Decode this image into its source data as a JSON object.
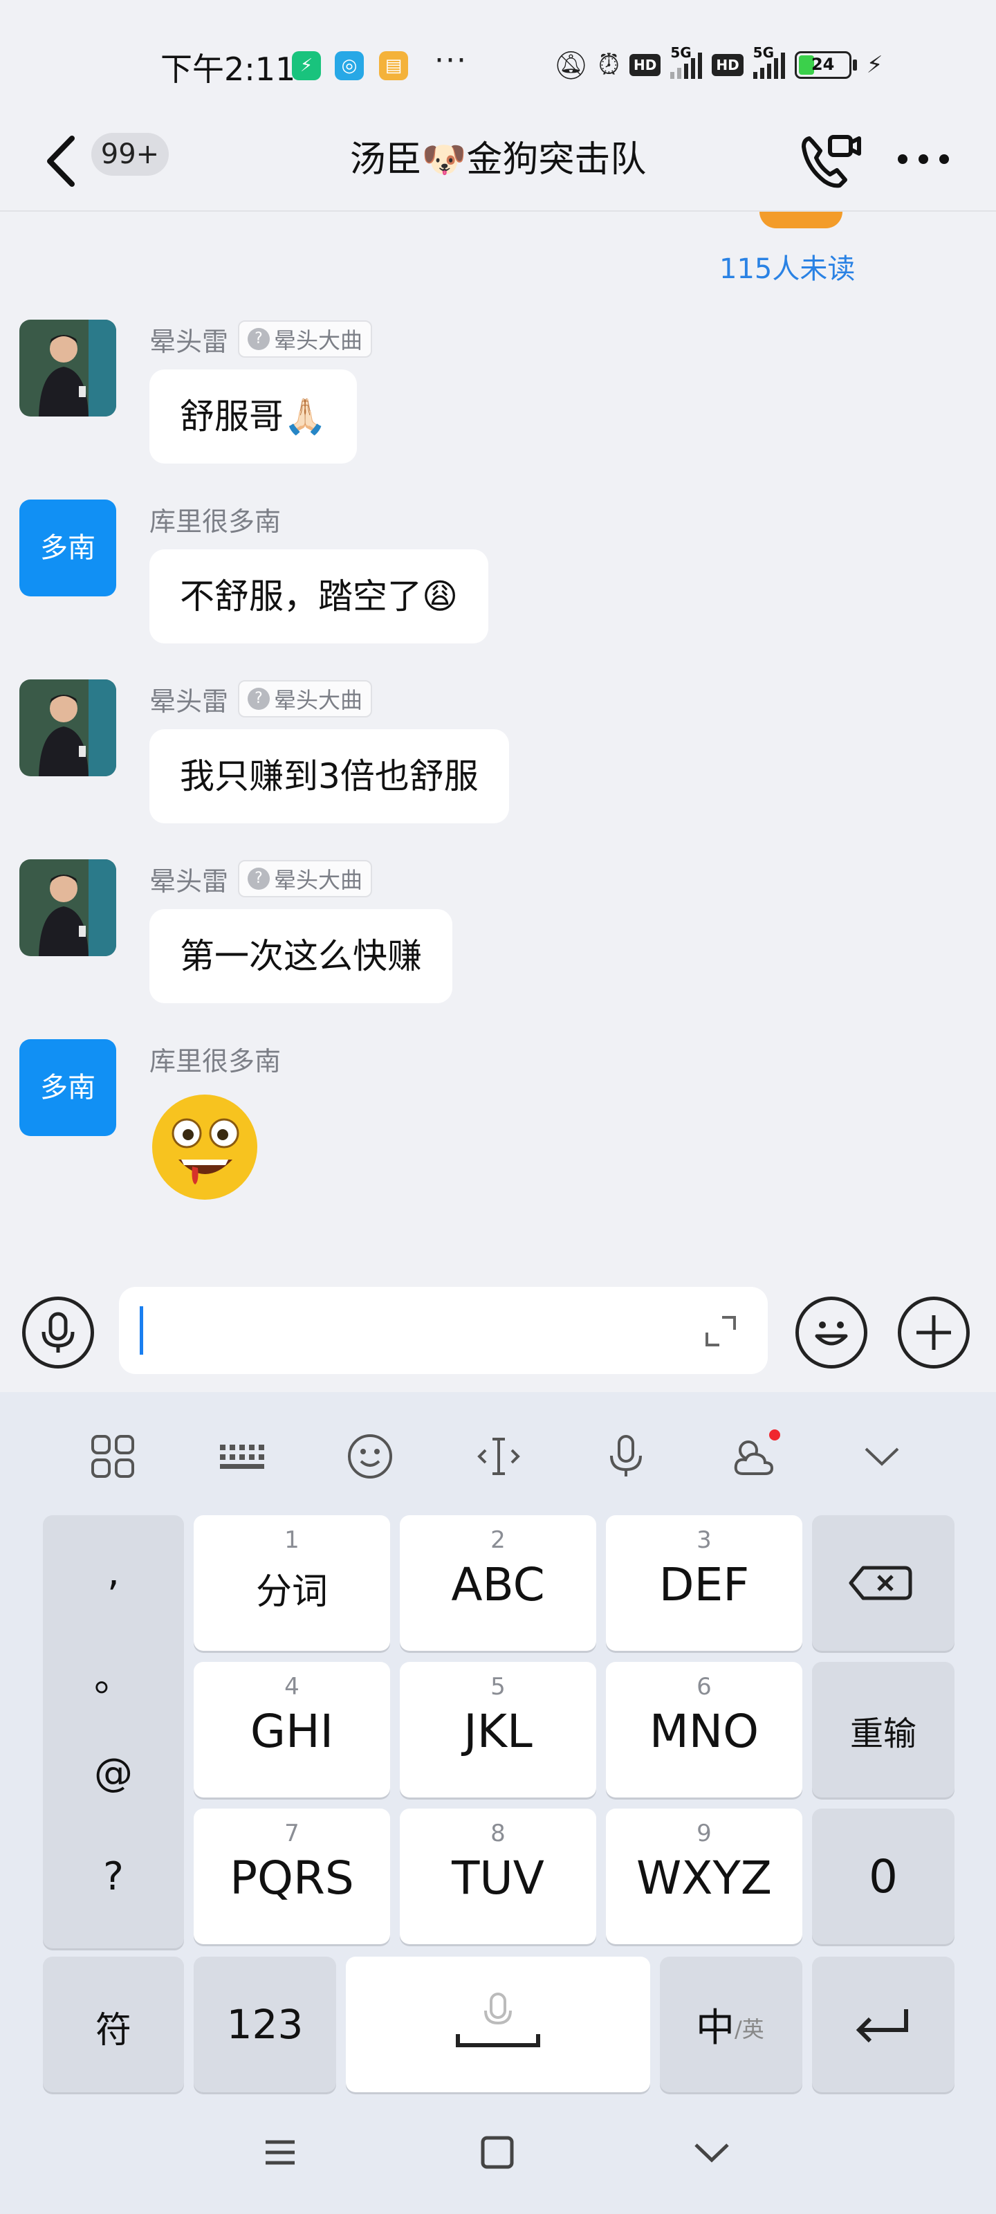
{
  "status_bar": {
    "time": "下午2:11",
    "dots": "···",
    "network_5g": "5G",
    "hd": "HD",
    "battery": "24"
  },
  "header": {
    "unread_badge": "99+",
    "title": "汤臣🐶金狗突击队"
  },
  "chat": {
    "unread_notice": "115人未读",
    "messages": [
      {
        "sender": "晕头雷",
        "tag": "晕头大曲",
        "text": "舒服哥🙏🏻",
        "avatar": "photo"
      },
      {
        "sender": "库里很多南",
        "avatar_text": "多南",
        "text": "不舒服，踏空了😩"
      },
      {
        "sender": "晕头雷",
        "tag": "晕头大曲",
        "text": "我只赚到3倍也舒服",
        "avatar": "photo"
      },
      {
        "sender": "晕头雷",
        "tag": "晕头大曲",
        "text": "第一次这么快赚",
        "avatar": "photo"
      },
      {
        "sender": "库里很多南",
        "avatar_text": "多南",
        "sticker": "drooling-face-emoji"
      }
    ]
  },
  "input": {
    "value": "",
    "placeholder": ""
  },
  "keyboard": {
    "toolbar": [
      "apps-icon",
      "keyboard-icon",
      "emoji-icon",
      "cursor-icon",
      "mic-icon",
      "weather-icon",
      "collapse-icon"
    ],
    "punctuation": [
      ",",
      "。",
      "@",
      "?"
    ],
    "keys": [
      {
        "num": "1",
        "label": "分词"
      },
      {
        "num": "2",
        "label": "ABC"
      },
      {
        "num": "3",
        "label": "DEF"
      },
      {
        "num": "4",
        "label": "GHI"
      },
      {
        "num": "5",
        "label": "JKL"
      },
      {
        "num": "6",
        "label": "MNO"
      },
      {
        "num": "7",
        "label": "PQRS"
      },
      {
        "num": "8",
        "label": "TUV"
      },
      {
        "num": "9",
        "label": "WXYZ"
      }
    ],
    "retype": "重输",
    "zero": "0",
    "symbols": "符",
    "numbers": "123",
    "lang_main": "中",
    "lang_sub": "/英"
  },
  "colors": {
    "accent": "#1190f4",
    "link": "#2a82e4",
    "background": "#f0f1f5",
    "keyboard_bg": "#e6eaf2"
  }
}
